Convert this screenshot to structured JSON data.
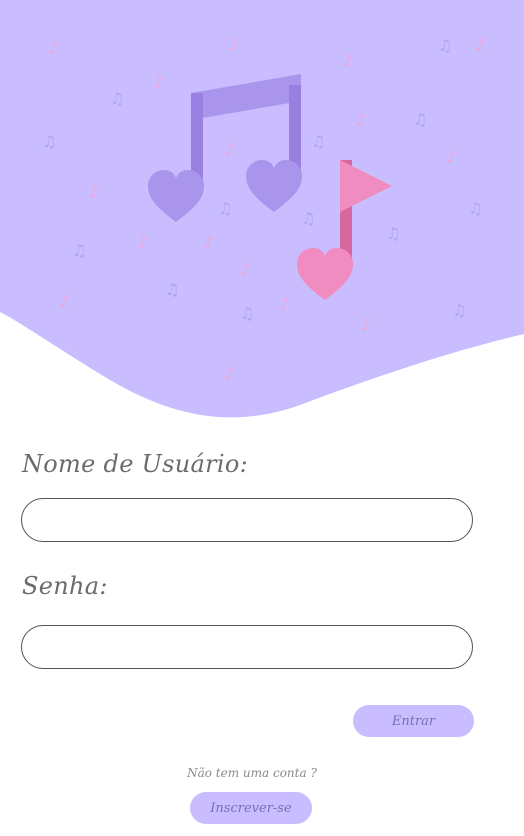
{
  "colors": {
    "hero_bg": "#c9bcff",
    "main_note": "#a995ec",
    "main_note_dark": "#9880e0",
    "accent_pink": "#f08cc0",
    "accent_pink_dark": "#d7679f",
    "small_note_purple": "#b2a4ef",
    "small_note_pink": "#f2a6d6"
  },
  "hero": {
    "illustration": "music-notes-with-hearts"
  },
  "form": {
    "username_label": "Nome de Usuário:",
    "username_value": "",
    "password_label": "Senha:",
    "password_value": ""
  },
  "actions": {
    "login_label": "Entrar",
    "no_account_text": "Não tem uma conta ?",
    "signup_label": "Inscrever-se"
  }
}
